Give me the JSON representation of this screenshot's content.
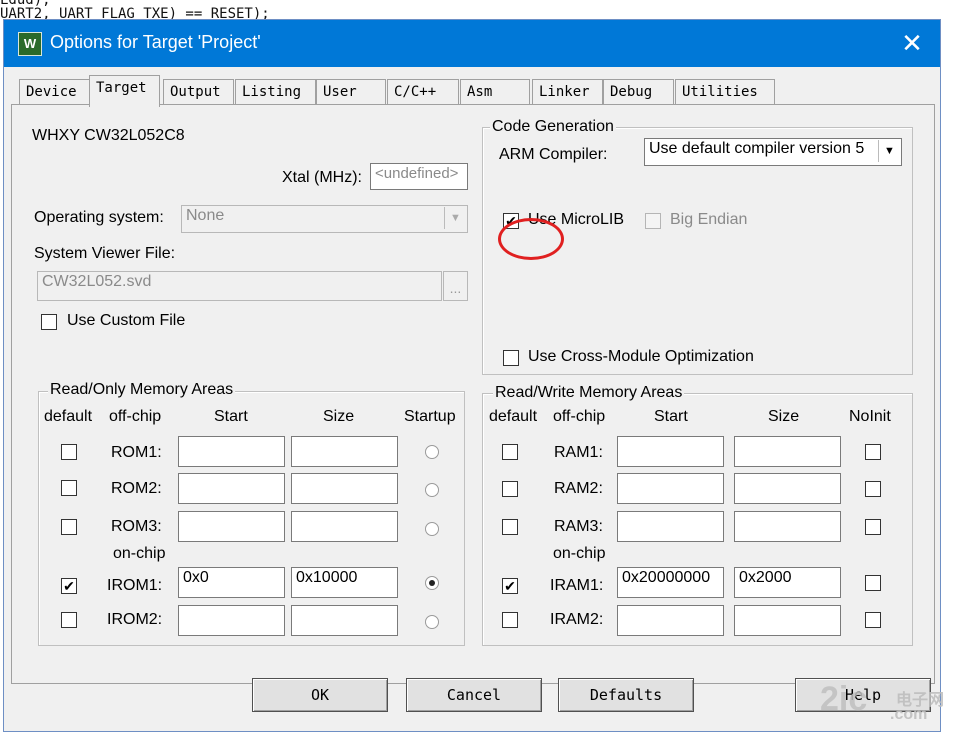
{
  "background": {
    "code_lines": [
      "Ldud);",
      "UART2, UART_FLAG_TXE) == RESET);"
    ]
  },
  "window": {
    "title": "Options for Target 'Project'",
    "icon_text": "W",
    "close_icon": "close-icon"
  },
  "tabs": [
    "Device",
    "Target",
    "Output",
    "Listing",
    "User",
    "C/C++",
    "Asm",
    "Linker",
    "Debug",
    "Utilities"
  ],
  "active_tab": "Target",
  "target": {
    "device_name": "WHXY CW32L052C8",
    "xtal_label": "Xtal (MHz):",
    "xtal_value": "<undefined>",
    "os_label": "Operating system:",
    "os_value": "None",
    "svd_label": "System Viewer File:",
    "svd_value": "CW32L052.svd",
    "browse_label": "...",
    "custom_file_label": "Use Custom File"
  },
  "codegen": {
    "group_title": "Code Generation",
    "compiler_label": "ARM Compiler:",
    "compiler_value": "Use default compiler version 5",
    "microlib_label": "Use MicroLIB",
    "microlib_checked": true,
    "big_endian_label": "Big Endian",
    "cross_module_label": "Use Cross-Module Optimization"
  },
  "rom": {
    "group_title": "Read/Only Memory Areas",
    "headers": [
      "default",
      "off-chip",
      "Start",
      "Size",
      "Startup"
    ],
    "onchip_label": "on-chip",
    "rows": [
      {
        "label": "ROM1:",
        "start": "",
        "size": "",
        "checked": false,
        "startup": false
      },
      {
        "label": "ROM2:",
        "start": "",
        "size": "",
        "checked": false,
        "startup": false
      },
      {
        "label": "ROM3:",
        "start": "",
        "size": "",
        "checked": false,
        "startup": false
      },
      {
        "label": "IROM1:",
        "start": "0x0",
        "size": "0x10000",
        "checked": true,
        "startup": true
      },
      {
        "label": "IROM2:",
        "start": "",
        "size": "",
        "checked": false,
        "startup": false
      }
    ]
  },
  "ram": {
    "group_title": "Read/Write Memory Areas",
    "headers": [
      "default",
      "off-chip",
      "Start",
      "Size",
      "NoInit"
    ],
    "onchip_label": "on-chip",
    "rows": [
      {
        "label": "RAM1:",
        "start": "",
        "size": "",
        "checked": false
      },
      {
        "label": "RAM2:",
        "start": "",
        "size": "",
        "checked": false
      },
      {
        "label": "RAM3:",
        "start": "",
        "size": "",
        "checked": false
      },
      {
        "label": "IRAM1:",
        "start": "0x20000000",
        "size": "0x2000",
        "checked": true
      },
      {
        "label": "IRAM2:",
        "start": "",
        "size": "",
        "checked": false
      }
    ]
  },
  "buttons": {
    "ok": "OK",
    "cancel": "Cancel",
    "defaults": "Defaults",
    "help": "Help"
  },
  "watermark": {
    "main": "2ic",
    "top": "电子网",
    "bottom": ".com"
  }
}
